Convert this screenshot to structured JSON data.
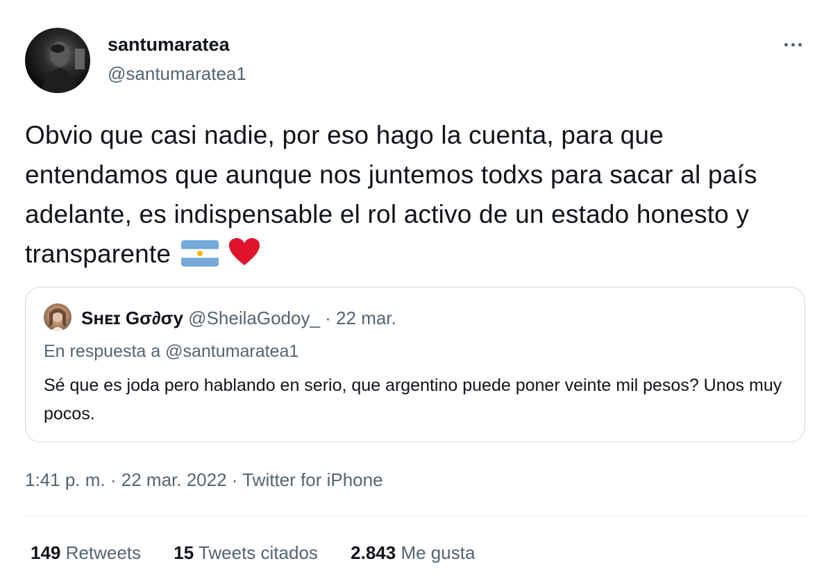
{
  "author": {
    "display_name": "santumaratea",
    "handle": "@santumaratea1"
  },
  "tweet": {
    "text": "Obvio que casi nadie, por eso hago la cuenta, para que entendamos que aunque nos juntemos todxs para sacar al país adelante, es indispensable el rol activo de un estado honesto y transparente",
    "emojis": [
      "argentina-flag-icon",
      "red-heart-icon"
    ]
  },
  "quote": {
    "display_name": "Sʜᴇɪ Gσ∂σу",
    "handle": "@SheilaGodoy_",
    "separator": "·",
    "date": "22 mar.",
    "reply_to": "En respuesta a @santumaratea1",
    "text": "Sé que es joda pero hablando en serio, que argentino puede poner veinte mil pesos? Unos muy pocos."
  },
  "meta": {
    "time": "1:41 p. m.",
    "sep1": "·",
    "date": "22 mar. 2022",
    "sep2": "·",
    "source": "Twitter for iPhone"
  },
  "stats": {
    "retweets_count": "149",
    "retweets_label": "Retweets",
    "quotes_count": "15",
    "quotes_label": "Tweets citados",
    "likes_count": "2.843",
    "likes_label": "Me gusta"
  },
  "colors": {
    "primary_text": "#0f1419",
    "secondary_text": "#536471",
    "border": "#cfd9de",
    "heart": "#e0142b",
    "flag_blue": "#75aadb"
  }
}
